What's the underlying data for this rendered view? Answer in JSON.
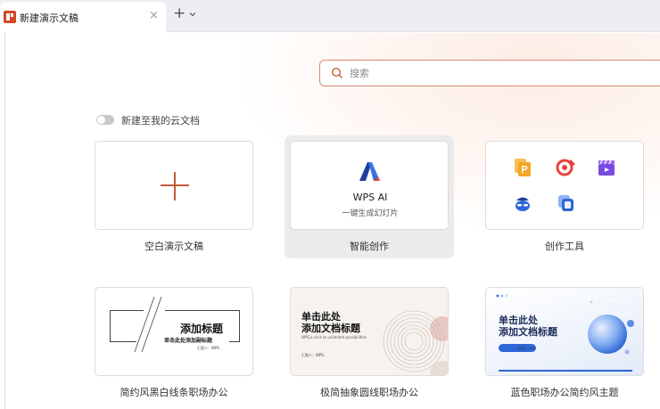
{
  "tab": {
    "title": "新建演示文稿",
    "close": "×",
    "new": "+"
  },
  "search": {
    "placeholder": "搜索"
  },
  "cloud": {
    "label": "新建至我的云文档"
  },
  "options": [
    {
      "caption": "空白演示文稿"
    },
    {
      "caption": "智能创作",
      "ai_title": "WPS AI",
      "ai_sub": "一键生成幻灯片"
    },
    {
      "caption": "创作工具"
    }
  ],
  "tools": [
    {
      "icon": "document-p-icon",
      "color": "#f5a623"
    },
    {
      "icon": "target-icon",
      "color": "#e8423c"
    },
    {
      "icon": "video-clapper-icon",
      "color": "#7b4be0"
    },
    {
      "icon": "character-icon",
      "color": "#2f66d6"
    },
    {
      "icon": "layers-icon",
      "color": "#2f66d6"
    }
  ],
  "templates": [
    {
      "caption": "简约风黑白线条职场办公",
      "title": "添加标题",
      "subtitle": "单击此处添加副标题",
      "author": "汇报人：WPS"
    },
    {
      "caption": "极简抽象圆线职场办公",
      "title_line1": "单击此处",
      "title_line2": "添加文档标题",
      "subtitle": "WPS,a click to unlimited possibilities",
      "author": "汇报人：WPS"
    },
    {
      "caption": "蓝色职场办公简约风主题",
      "title_line1": "单击此处",
      "title_line2": "添加文档标题",
      "author": "汇报人：WPS"
    }
  ],
  "colors": {
    "accent": "#c85a3c",
    "search_border": "#d98a70",
    "brand_blue": "#2f66d6"
  }
}
